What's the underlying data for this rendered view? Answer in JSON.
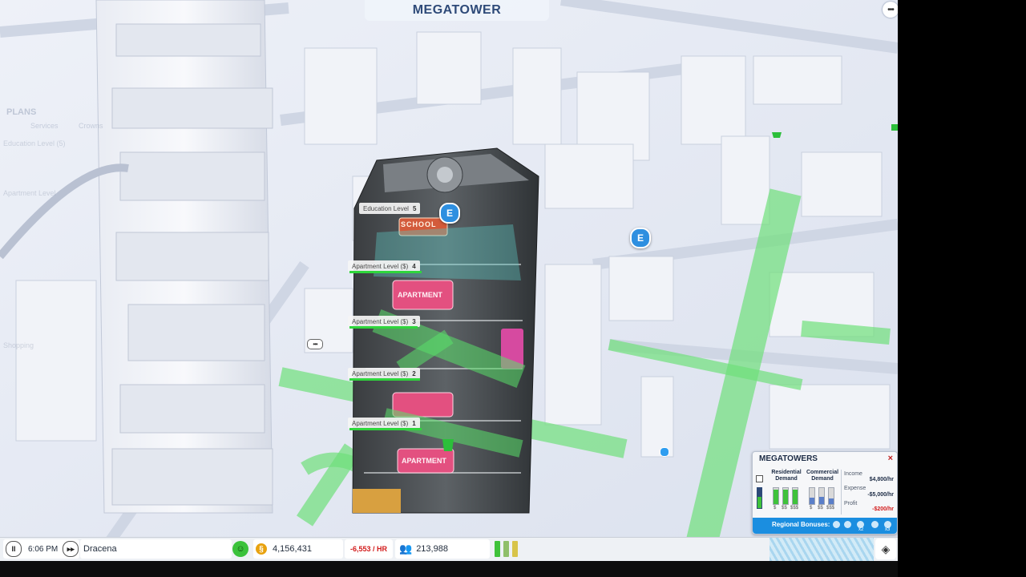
{
  "header": {
    "title": "MEGATOWER",
    "more_icon": "ellipsis-icon"
  },
  "ghost_panel": {
    "title": "PLANS",
    "tabs": [
      "Services",
      "Crowns"
    ],
    "rows": [
      "Education Level (5)",
      "Apartment Level",
      "Shopping"
    ]
  },
  "tower": {
    "levels": [
      {
        "label": "Education Level",
        "number": "5"
      },
      {
        "label": "Apartment Level ($)",
        "number": "4"
      },
      {
        "label": "Apartment Level ($)",
        "number": "3"
      },
      {
        "label": "Apartment Level ($)",
        "number": "2"
      },
      {
        "label": "Apartment Level ($)",
        "number": "1"
      }
    ],
    "signs": {
      "school": "SCHOOL",
      "apartment": "APARTMENT"
    },
    "pin_glyph": "E"
  },
  "statusbar": {
    "pause_icon": "pause-icon",
    "time": "6:06 PM",
    "fast_forward_icon": "fast-forward-icon",
    "city_name": "Dracena",
    "happiness_icon": "smiley-icon",
    "simoleon_symbol": "§",
    "funds": "4,156,431",
    "rate": "-6,553 / HR",
    "population_icon": "people-icon",
    "population": "213,988",
    "layers_icon": "layers-icon"
  },
  "megatowers_panel": {
    "title": "MEGATOWERS",
    "close": "×",
    "residential_label": "Residential Demand",
    "commercial_label": "Commercial Demand",
    "residential_ticks": [
      "$",
      "$$",
      "$$$"
    ],
    "commercial_ticks": [
      "$",
      "$$",
      "$$$"
    ],
    "residential_levels": [
      0.9,
      0.9,
      0.9
    ],
    "commercial_levels": [
      0.4,
      0.45,
      0.35
    ],
    "income_label": "Income",
    "income_value": "$4,800/hr",
    "expense_label": "Expense",
    "expense_value": "-$5,000/hr",
    "profit_label": "Profit",
    "profit_value": "-$200/hr",
    "regional_label": "Regional Bonuses:",
    "bonus_counts": [
      "x2",
      "x3"
    ],
    "colors": {
      "accent": "#1b8ee0",
      "demand_green": "#3fc23b",
      "demand_blue": "#5b7fc9",
      "negative": "#d21a1a"
    }
  }
}
